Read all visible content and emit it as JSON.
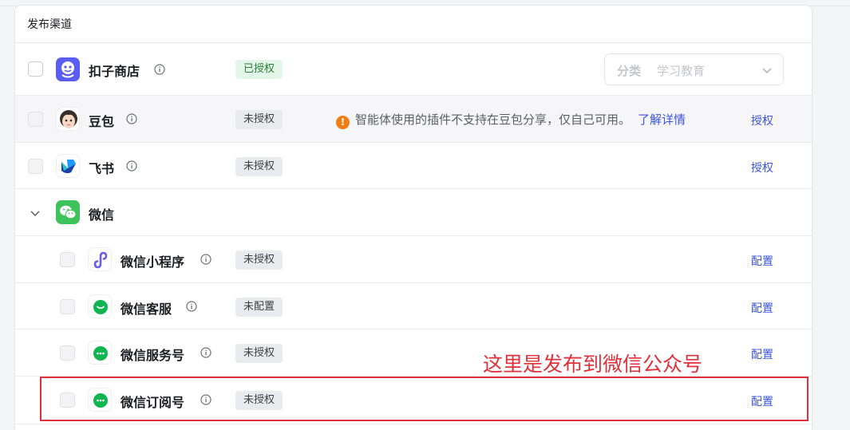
{
  "panel": {
    "title": "发布渠道"
  },
  "channels": {
    "kouzi": {
      "name": "扣子商店",
      "status": "已授权",
      "category_label": "分类",
      "category_value": "学习教育"
    },
    "doubao": {
      "name": "豆包",
      "status": "未授权",
      "notice": "智能体使用的插件不支持在豆包分享，仅自己可用。",
      "notice_link": "了解详情",
      "action": "授权"
    },
    "feishu": {
      "name": "飞书",
      "status": "未授权",
      "action": "授权"
    },
    "wechat": {
      "name": "微信"
    },
    "mini_program": {
      "name": "微信小程序",
      "status": "未授权",
      "action": "配置"
    },
    "customer_service": {
      "name": "微信客服",
      "status": "未配置",
      "action": "配置"
    },
    "service_account": {
      "name": "微信服务号",
      "status": "未授权",
      "action": "配置"
    },
    "subscription": {
      "name": "微信订阅号",
      "status": "未授权",
      "action": "配置"
    }
  },
  "annotation": {
    "text": "这里是发布到微信公众号",
    "color": "#e0313a"
  },
  "colors": {
    "link": "#3c54e0",
    "authorized_tag": "#26803a",
    "warning": "#f27d14"
  }
}
